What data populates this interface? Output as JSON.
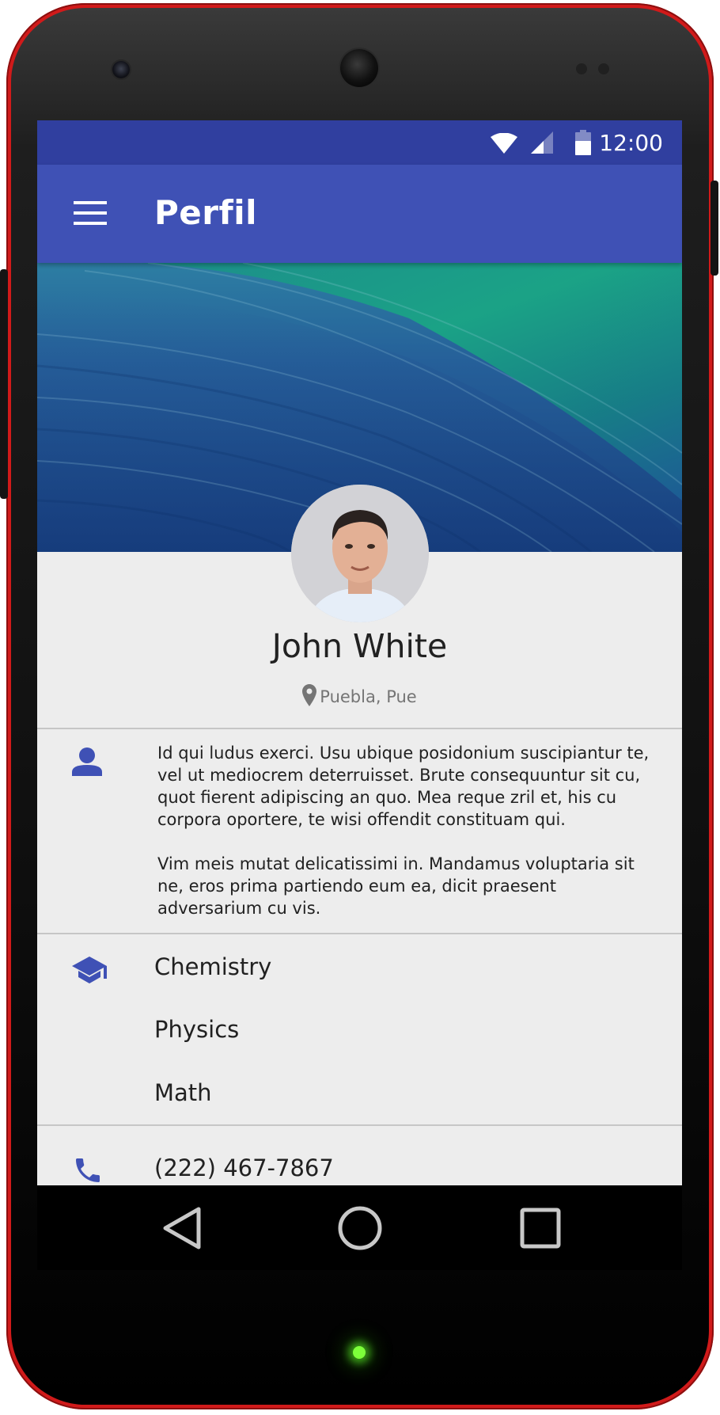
{
  "status_bar": {
    "time": "12:00",
    "icons": [
      "wifi-icon",
      "cellular-signal-icon",
      "battery-icon"
    ]
  },
  "app_bar": {
    "title": "Perfil",
    "menu_icon": "menu-icon"
  },
  "profile": {
    "name": "John White",
    "location": "Puebla, Pue",
    "location_icon": "map-pin-icon"
  },
  "about": {
    "icon": "person-icon",
    "paragraphs": [
      "Id qui ludus exerci. Usu ubique posidonium suscipiantur te, vel ut mediocrem deterruisset. Brute consequuntur sit cu, quot fierent adipiscing an quo. Mea reque zril et, his cu corpora oportere, te wisi offendit constituam qui.",
      "Vim meis mutat delicatissimi in. Mandamus voluptaria sit ne, eros prima partiendo eum ea, dicit praesent adversarium cu vis."
    ]
  },
  "education": {
    "icon": "school-icon",
    "subjects": [
      "Chemistry",
      "Physics",
      "Math"
    ]
  },
  "contact": {
    "icon": "phone-icon",
    "phone": "(222) 467-7867"
  },
  "nav_bar": {
    "icons": [
      "back-icon",
      "home-icon",
      "recents-icon"
    ]
  },
  "colors": {
    "phone_body": "#d11a1a",
    "status_bar": "#303f9f",
    "primary": "#3f51b5",
    "background": "#ededed",
    "text_primary": "#212121",
    "text_secondary": "#757575",
    "notification_led": "#7dff3a"
  }
}
